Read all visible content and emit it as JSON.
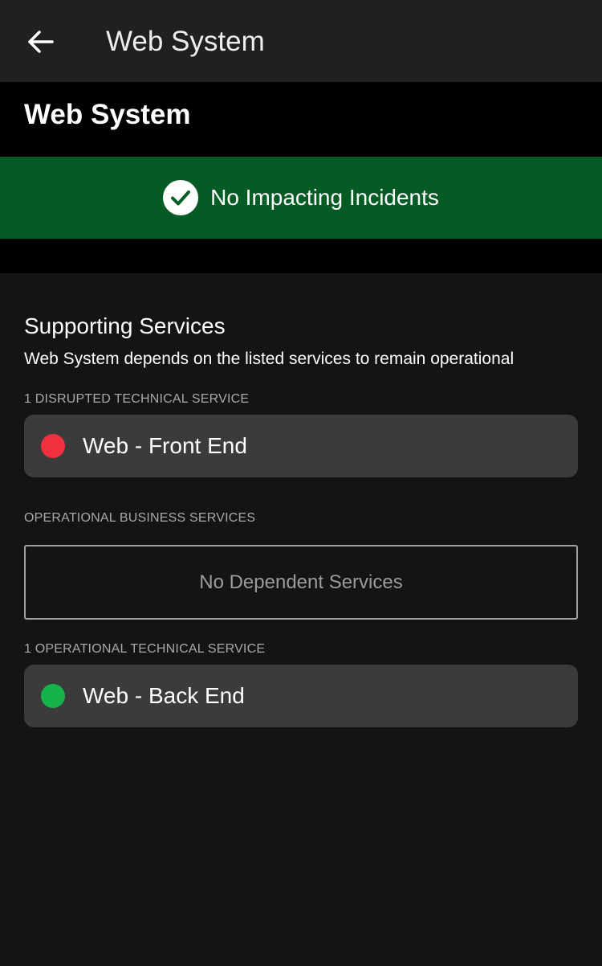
{
  "app_bar": {
    "title": "Web System",
    "back_icon": "arrow-left-icon"
  },
  "header": {
    "title": "Web System"
  },
  "status_banner": {
    "icon": "check-circle-icon",
    "text": "No Impacting Incidents",
    "color": "#055b24"
  },
  "supporting_services": {
    "title": "Supporting Services",
    "subtitle": "Web System depends on the listed services to remain operational",
    "groups": [
      {
        "label": "1 DISRUPTED TECHNICAL SERVICE",
        "services": [
          {
            "name": "Web - Front End",
            "status": "disrupted",
            "color": "#f0303e"
          }
        ]
      },
      {
        "label": "OPERATIONAL BUSINESS SERVICES",
        "empty_text": "No Dependent Services"
      },
      {
        "label": "1 OPERATIONAL TECHNICAL SERVICE",
        "services": [
          {
            "name": "Web - Back End",
            "status": "operational",
            "color": "#16b34a"
          }
        ]
      }
    ]
  },
  "colors": {
    "background": "#141414",
    "app_bar": "#202020",
    "header_band": "#000000",
    "card": "#3b3b3b"
  }
}
